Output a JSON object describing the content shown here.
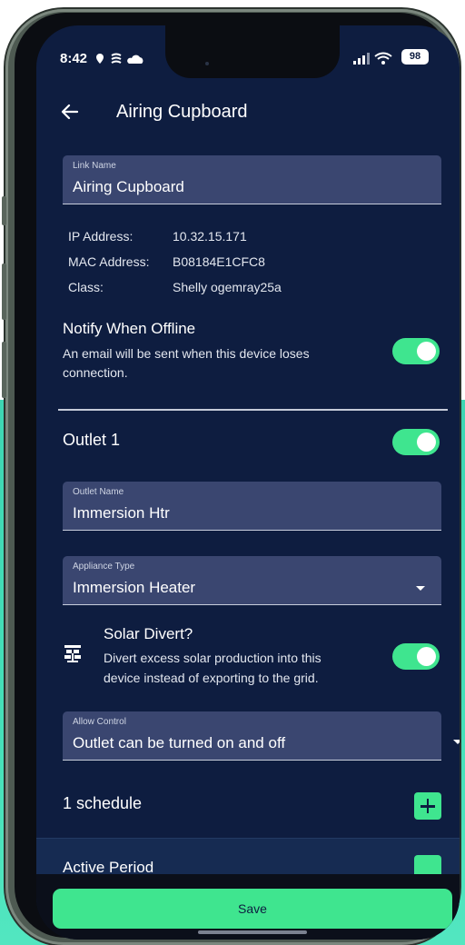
{
  "status_bar": {
    "time": "8:42",
    "battery": "98"
  },
  "header": {
    "title": "Airing Cupboard"
  },
  "link_name": {
    "label": "Link Name",
    "value": "Airing Cupboard"
  },
  "device_info": [
    {
      "key": "IP Address:",
      "value": "10.32.15.171"
    },
    {
      "key": "MAC Address:",
      "value": "B08184E1CFC8"
    },
    {
      "key": "Class:",
      "value": "Shelly ogemray25a"
    }
  ],
  "notify": {
    "title": "Notify When Offline",
    "line1": "An email will be sent when this device loses",
    "line2": "connection.",
    "enabled": true
  },
  "outlet": {
    "title": "Outlet 1",
    "enabled": true,
    "name_label": "Outlet Name",
    "name_value": "Immersion Htr",
    "appliance_label": "Appliance Type",
    "appliance_value": "Immersion Heater"
  },
  "solar_divert": {
    "title": "Solar Divert?",
    "line1": "Divert excess solar production into this",
    "line2": "device instead of exporting to the grid.",
    "icon": "solar-panel-icon",
    "enabled": true
  },
  "allow_control": {
    "label": "Allow Control",
    "value": "Outlet can be turned on and off"
  },
  "schedule": {
    "label": "1 schedule"
  },
  "active_period": {
    "label": "Active Period"
  },
  "footer": {
    "save_label": "Save"
  },
  "colors": {
    "background": "#0e1d40",
    "field": "#3a4670",
    "accent": "#3fe58f",
    "phone_frame": "#4e5a52",
    "outside": "#46e0b9"
  }
}
